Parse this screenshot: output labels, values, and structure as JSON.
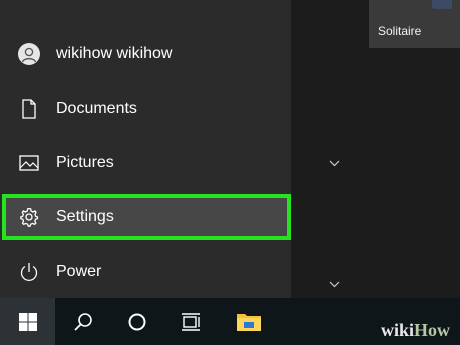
{
  "menu": {
    "items": [
      {
        "label": "wikihow wikihow",
        "icon": "user-avatar-icon"
      },
      {
        "label": "Documents",
        "icon": "document-icon"
      },
      {
        "label": "Pictures",
        "icon": "picture-icon"
      },
      {
        "label": "Settings",
        "icon": "gear-icon"
      },
      {
        "label": "Power",
        "icon": "power-icon"
      }
    ]
  },
  "tiles": {
    "solitaire_label": "Solitaire"
  },
  "taskbar": {
    "icons": [
      "windows-start-icon",
      "search-icon",
      "cortana-icon",
      "task-view-icon",
      "file-explorer-icon"
    ]
  },
  "watermark": {
    "wiki": "wiki",
    "how": "How"
  },
  "colors": {
    "highlight": "#25e41f",
    "menu_bg": "#2b2b2b",
    "tiles_bg": "#1c1c1c",
    "taskbar_bg": "#0f1619",
    "selected_item_bg": "#474747"
  }
}
